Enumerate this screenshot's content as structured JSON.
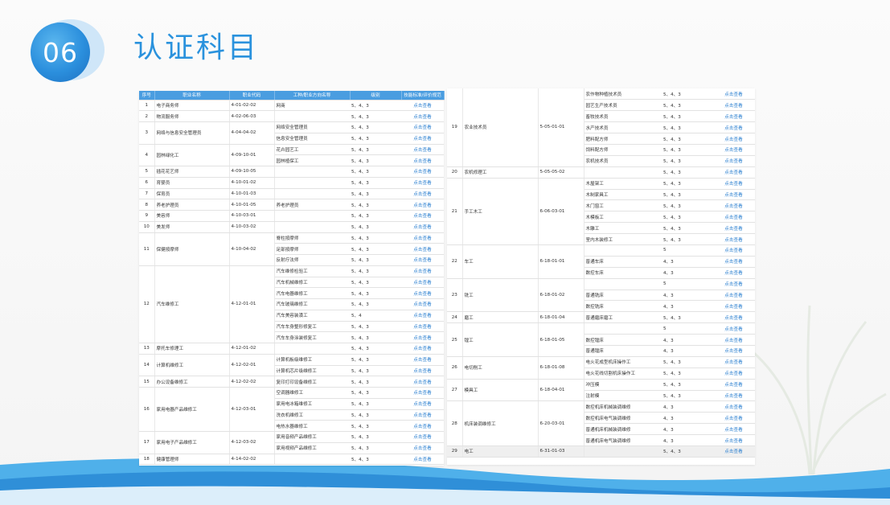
{
  "header": {
    "number": "06",
    "title": "认证科目"
  },
  "table_left": {
    "columns": [
      "序号",
      "职业名称",
      "职业代码",
      "工种/职业方向名称",
      "级别",
      "技能标准/评价规范"
    ],
    "rows": [
      [
        {
          "v": "1",
          "rs": 1
        },
        {
          "v": "电子商务师",
          "rs": 1
        },
        {
          "v": "4-01-02-02",
          "rs": 1
        },
        "网商",
        "5、4、3",
        "点击查看"
      ],
      [
        {
          "v": "2",
          "rs": 1
        },
        {
          "v": "物流服务师",
          "rs": 1
        },
        {
          "v": "4-02-06-03",
          "rs": 1
        },
        "",
        "5、4、3",
        "点击查看"
      ],
      [
        {
          "v": "3",
          "rs": 2
        },
        {
          "v": "网络与信息安全管理员",
          "rs": 2
        },
        {
          "v": "4-04-04-02",
          "rs": 2
        },
        "网络安全管理员",
        "5、4、3",
        "点击查看"
      ],
      [
        null,
        null,
        null,
        "信息安全管理员",
        "5、4、3",
        "点击查看"
      ],
      [
        {
          "v": "4",
          "rs": 2
        },
        {
          "v": "园林绿化工",
          "rs": 2
        },
        {
          "v": "4-09-10-01",
          "rs": 2
        },
        "花卉园艺工",
        "5、4、3",
        "点击查看"
      ],
      [
        null,
        null,
        null,
        "园林植保工",
        "5、4、3",
        "点击查看"
      ],
      [
        {
          "v": "5",
          "rs": 1
        },
        {
          "v": "插花花艺师",
          "rs": 1
        },
        {
          "v": "4-09-10-05",
          "rs": 1
        },
        "",
        "5、4、3",
        "点击查看"
      ],
      [
        {
          "v": "6",
          "rs": 1
        },
        {
          "v": "育婴员",
          "rs": 1
        },
        {
          "v": "4-10-01-02",
          "rs": 1
        },
        "",
        "5、4、3",
        "点击查看"
      ],
      [
        {
          "v": "7",
          "rs": 1
        },
        {
          "v": "保育员",
          "rs": 1
        },
        {
          "v": "4-10-01-03",
          "rs": 1
        },
        "",
        "5、4、3",
        "点击查看"
      ],
      [
        {
          "v": "8",
          "rs": 1
        },
        {
          "v": "养老护理员",
          "rs": 1
        },
        {
          "v": "4-10-01-05",
          "rs": 1
        },
        "养老护理员",
        "5、4、3",
        "点击查看"
      ],
      [
        {
          "v": "9",
          "rs": 1
        },
        {
          "v": "美容师",
          "rs": 1
        },
        {
          "v": "4-10-03-01",
          "rs": 1
        },
        "",
        "5、4、3",
        "点击查看"
      ],
      [
        {
          "v": "10",
          "rs": 1
        },
        {
          "v": "美发师",
          "rs": 1
        },
        {
          "v": "4-10-03-02",
          "rs": 1
        },
        "",
        "5、4、3",
        "点击查看"
      ],
      [
        {
          "v": "11",
          "rs": 3
        },
        {
          "v": "保健按摩师",
          "rs": 3
        },
        {
          "v": "4-10-04-02",
          "rs": 3
        },
        "脊柱按摩师",
        "5、4、3",
        "点击查看"
      ],
      [
        null,
        null,
        null,
        "足部按摩师",
        "5、4、3",
        "点击查看"
      ],
      [
        null,
        null,
        null,
        "反射疗法师",
        "5、4、3",
        "点击查看"
      ],
      [
        {
          "v": "12",
          "rs": 7
        },
        {
          "v": "汽车维修工",
          "rs": 7
        },
        {
          "v": "4-12-01-01",
          "rs": 7
        },
        "汽车维修检验工",
        "5、4、3",
        "点击查看"
      ],
      [
        null,
        null,
        null,
        "汽车机械维修工",
        "5、4、3",
        "点击查看"
      ],
      [
        null,
        null,
        null,
        "汽车电器维修工",
        "5、4、3",
        "点击查看"
      ],
      [
        null,
        null,
        null,
        "汽车玻璃维修工",
        "5、4、3",
        "点击查看"
      ],
      [
        null,
        null,
        null,
        "汽车美容装潢工",
        "5、4",
        "点击查看"
      ],
      [
        null,
        null,
        null,
        "汽车车身整形修复工",
        "5、4、3",
        "点击查看"
      ],
      [
        null,
        null,
        null,
        "汽车车身涂装修复工",
        "5、4、3",
        "点击查看"
      ],
      [
        {
          "v": "13",
          "rs": 1
        },
        {
          "v": "摩托车修理工",
          "rs": 1
        },
        {
          "v": "4-12-01-02",
          "rs": 1
        },
        "",
        "5、4、3",
        "点击查看"
      ],
      [
        {
          "v": "14",
          "rs": 2
        },
        {
          "v": "计算机维修工",
          "rs": 2
        },
        {
          "v": "4-12-02-01",
          "rs": 2
        },
        "计算机板级维修工",
        "5、4、3",
        "点击查看"
      ],
      [
        null,
        null,
        null,
        "计算机芯片级维修工",
        "5、4、3",
        "点击查看"
      ],
      [
        {
          "v": "15",
          "rs": 1
        },
        {
          "v": "办公设备维修工",
          "rs": 1
        },
        {
          "v": "4-12-02-02",
          "rs": 1
        },
        "复印打印设备维修工",
        "5、4、3",
        "点击查看"
      ],
      [
        {
          "v": "16",
          "rs": 4
        },
        {
          "v": "家用电器产品维修工",
          "rs": 4
        },
        {
          "v": "4-12-03-01",
          "rs": 4
        },
        "空调器维修工",
        "5、4、3",
        "点击查看"
      ],
      [
        null,
        null,
        null,
        "家用电冰箱维修工",
        "5、4、3",
        "点击查看"
      ],
      [
        null,
        null,
        null,
        "洗衣机维修工",
        "5、4、3",
        "点击查看"
      ],
      [
        null,
        null,
        null,
        "电热水器维修工",
        "5、4、3",
        "点击查看"
      ],
      [
        {
          "v": "17",
          "rs": 2
        },
        {
          "v": "家用电子产品维修工",
          "rs": 2
        },
        {
          "v": "4-12-03-02",
          "rs": 2
        },
        "家用音频产品维修工",
        "5、4、3",
        "点击查看"
      ],
      [
        null,
        null,
        null,
        "家用视频产品维修工",
        "5、4、3",
        "点击查看"
      ],
      [
        {
          "v": "18",
          "rs": 1
        },
        {
          "v": "健康管理师",
          "rs": 1
        },
        {
          "v": "4-14-02-02",
          "rs": 1
        },
        "",
        "5、4、3",
        "点击查看"
      ]
    ]
  },
  "table_right": {
    "rows": [
      [
        {
          "v": "19",
          "rs": 7
        },
        {
          "v": "农业技术员",
          "rs": 7
        },
        {
          "v": "5-05-01-01",
          "rs": 7
        },
        "农作物种植技术员",
        "5、4、3",
        "点击查看"
      ],
      [
        null,
        null,
        null,
        "园艺生产技术员",
        "5、4、3",
        "点击查看"
      ],
      [
        null,
        null,
        null,
        "畜牧技术员",
        "5、4、3",
        "点击查看"
      ],
      [
        null,
        null,
        null,
        "水产技术员",
        "5、4、3",
        "点击查看"
      ],
      [
        null,
        null,
        null,
        "肥料配方师",
        "5、4、3",
        "点击查看"
      ],
      [
        null,
        null,
        null,
        "饲料配方师",
        "5、4、3",
        "点击查看"
      ],
      [
        null,
        null,
        null,
        "农机技术员",
        "5、4、3",
        "点击查看"
      ],
      [
        {
          "v": "20",
          "rs": 1
        },
        {
          "v": "农机修理工",
          "rs": 1
        },
        {
          "v": "5-05-05-02",
          "rs": 1
        },
        "",
        "5、4、3",
        "点击查看"
      ],
      [
        {
          "v": "21",
          "rs": 6
        },
        {
          "v": "手工木工",
          "rs": 6
        },
        {
          "v": "6-06-03-01",
          "rs": 6
        },
        "木屋架工",
        "5、4、3",
        "点击查看"
      ],
      [
        null,
        null,
        null,
        "木制家具工",
        "5、4、3",
        "点击查看"
      ],
      [
        null,
        null,
        null,
        "木门窗工",
        "5、4、3",
        "点击查看"
      ],
      [
        null,
        null,
        null,
        "木模板工",
        "5、4、3",
        "点击查看"
      ],
      [
        null,
        null,
        null,
        "木雕工",
        "5、4、3",
        "点击查看"
      ],
      [
        null,
        null,
        null,
        "室内木装修工",
        "5、4、3",
        "点击查看"
      ],
      [
        {
          "v": "22",
          "rs": 3
        },
        {
          "v": "车工",
          "rs": 3
        },
        {
          "v": "6-18-01-01",
          "rs": 3
        },
        "",
        "5",
        "点击查看"
      ],
      [
        null,
        null,
        null,
        "普通车床",
        "4、3",
        "点击查看"
      ],
      [
        null,
        null,
        null,
        "数控车床",
        "4、3",
        "点击查看"
      ],
      [
        {
          "v": "23",
          "rs": 3
        },
        {
          "v": "铣工",
          "rs": 3
        },
        {
          "v": "6-18-01-02",
          "rs": 3
        },
        "",
        "5",
        "点击查看"
      ],
      [
        null,
        null,
        null,
        "普通铣床",
        "4、3",
        "点击查看"
      ],
      [
        null,
        null,
        null,
        "数控铣床",
        "4、3",
        "点击查看"
      ],
      [
        {
          "v": "24",
          "rs": 1
        },
        {
          "v": "磨工",
          "rs": 1
        },
        {
          "v": "6-18-01-04",
          "rs": 1
        },
        "普通磨床磨工",
        "5、4、3",
        "点击查看"
      ],
      [
        {
          "v": "25",
          "rs": 3
        },
        {
          "v": "镗工",
          "rs": 3
        },
        {
          "v": "6-18-01-05",
          "rs": 3
        },
        "",
        "5",
        "点击查看"
      ],
      [
        null,
        null,
        null,
        "数控镗床",
        "4、3",
        "点击查看"
      ],
      [
        null,
        null,
        null,
        "普通镗床",
        "4、3",
        "点击查看"
      ],
      [
        {
          "v": "26",
          "rs": 2
        },
        {
          "v": "电切削工",
          "rs": 2
        },
        {
          "v": "6-18-01-08",
          "rs": 2
        },
        "电火花成型机床操作工",
        "5、4、3",
        "点击查看"
      ],
      [
        null,
        null,
        null,
        "电火花线切割机床操作工",
        "5、4、3",
        "点击查看"
      ],
      [
        {
          "v": "27",
          "rs": 2
        },
        {
          "v": "模具工",
          "rs": 2
        },
        {
          "v": "6-18-04-01",
          "rs": 2
        },
        "冲压模",
        "5、4、3",
        "点击查看"
      ],
      [
        null,
        null,
        null,
        "注射模",
        "5、4、3",
        "点击查看"
      ],
      [
        {
          "v": "28",
          "rs": 4
        },
        {
          "v": "机床装调维修工",
          "rs": 4
        },
        {
          "v": "6-20-03-01",
          "rs": 4
        },
        "数控机床机械装调维修",
        "4、3",
        "点击查看"
      ],
      [
        null,
        null,
        null,
        "数控机床电气装调维修",
        "4、3",
        "点击查看"
      ],
      [
        null,
        null,
        null,
        "普通机床机械装调维修",
        "4、3",
        "点击查看"
      ],
      [
        null,
        null,
        null,
        "普通机床电气装调维修",
        "4、3",
        "点击查看"
      ],
      [
        {
          "v": "29",
          "rs": 1
        },
        {
          "v": "电工",
          "rs": 1
        },
        {
          "v": "6-31-01-03",
          "rs": 1
        },
        "",
        "5、4、3",
        "点击查看"
      ]
    ]
  },
  "colors": {
    "accent": "#2a92dd",
    "header_bg": "#4a9de0",
    "link": "#2a7fd0"
  }
}
